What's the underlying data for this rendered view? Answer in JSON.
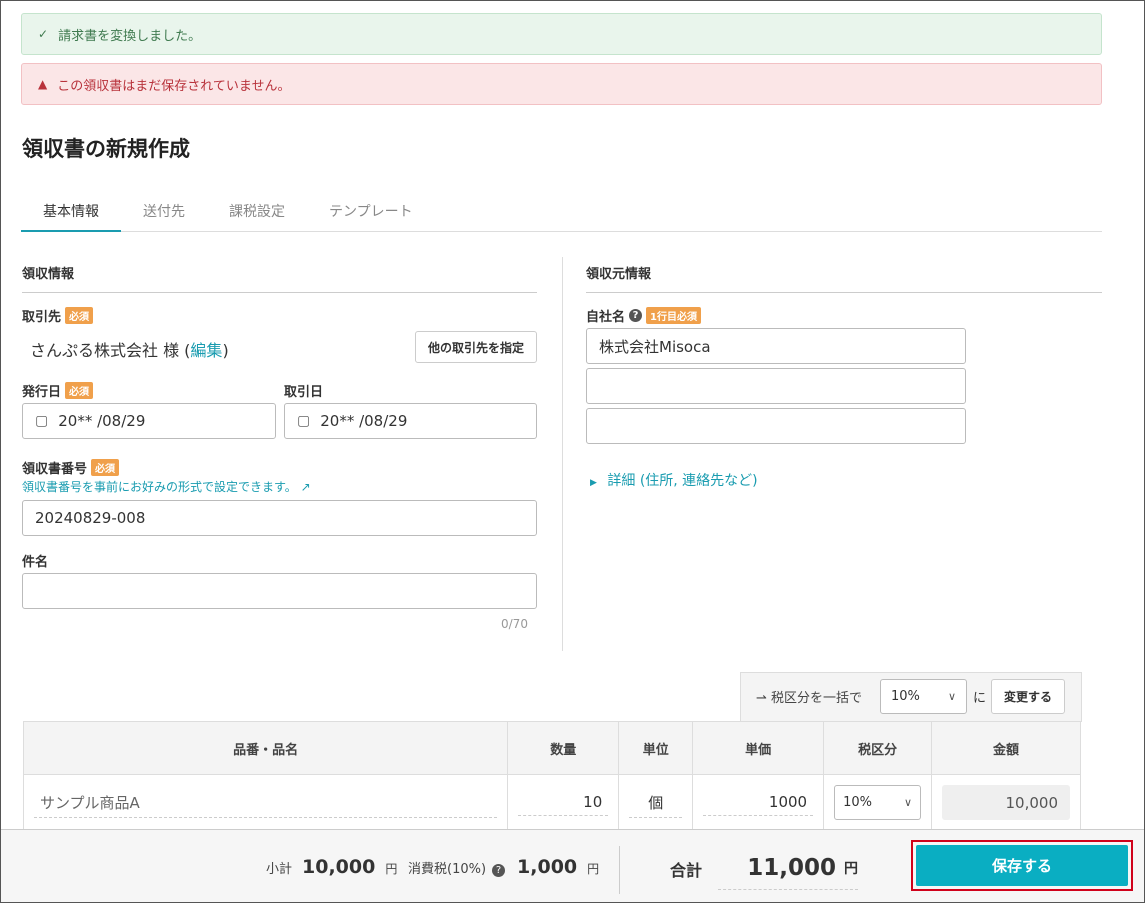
{
  "alerts": {
    "success": "請求書を変換しました。",
    "danger": "この領収書はまだ保存されていません。"
  },
  "page_title": "領収書の新規作成",
  "tabs": [
    "基本情報",
    "送付先",
    "課税設定",
    "テンプレート"
  ],
  "left": {
    "section": "領収情報",
    "client_label": "取引先",
    "required": "必須",
    "client_name": "さんぷる株式会社 様 (",
    "edit_link": "編集",
    "client_close": ")",
    "other_client_button": "他の取引先を指定",
    "issue_date_label": "発行日",
    "issue_date": "20** /08/29",
    "trade_date_label": "取引日",
    "trade_date": "20** /08/29",
    "receipt_no_label": "領収書番号",
    "receipt_no_hint": "領収書番号を事前にお好みの形式で設定できます。",
    "receipt_no": "20240829-008",
    "subject_label": "件名",
    "subject_value": "",
    "subject_count": "0/70"
  },
  "right": {
    "section": "領収元情報",
    "company_label": "自社名",
    "company_required": "1行目必須",
    "company_line1": "株式会社Misoca",
    "company_line2": "",
    "company_line3": "",
    "details_link": "詳細 (住所, 連絡先など)"
  },
  "bulk_tax": {
    "label": "税区分を一括で",
    "selected": "10%",
    "suffix": "に",
    "button": "変更する"
  },
  "table": {
    "headers": [
      "品番・品名",
      "数量",
      "単位",
      "単価",
      "税区分",
      "金額"
    ],
    "rows": [
      {
        "name": "サンプル商品A",
        "qty": "10",
        "unit": "個",
        "price": "1000",
        "tax": "10%",
        "amount": "10,000"
      }
    ]
  },
  "footer": {
    "subtotal_label": "小計",
    "subtotal": "10,000",
    "yen": "円",
    "tax_label": "消費税(10%)",
    "tax": "1,000",
    "total_label": "合計",
    "total": "11,000",
    "save_button": "保存する"
  },
  "colors": {
    "accent": "#1a9cb0",
    "required": "#f0a04b",
    "save": "#0aaec2",
    "highlight": "#d0021b"
  }
}
